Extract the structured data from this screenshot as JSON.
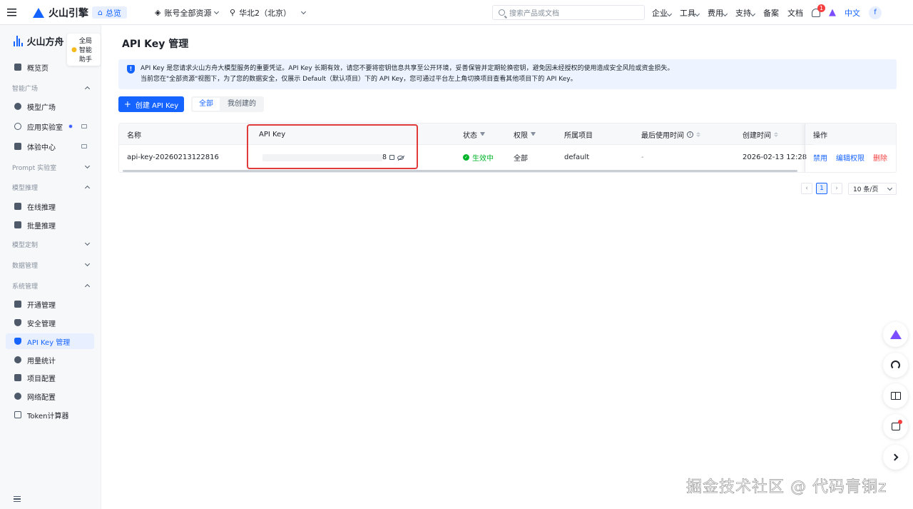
{
  "topnav": {
    "brand": "火山引擎",
    "overview": "总览",
    "account_scope": "账号全部资源",
    "region": "华北2（北京）",
    "search_placeholder": "搜索产品或文档",
    "links": [
      "企业",
      "工具",
      "费用",
      "支持",
      "备案",
      "文档"
    ],
    "notification_count": "1",
    "language": "中文",
    "avatar_letter": "f"
  },
  "sidebar": {
    "brand": "火山方舟",
    "assistant_tip": "全局智能助手",
    "overview": "概览页",
    "groups": {
      "smart_square": "智能广场",
      "prompt_lab": "Prompt 实验室",
      "model_inference": "模型推理",
      "model_custom": "模型定制",
      "data_mgmt": "数据管理",
      "system_mgmt": "系统管理"
    },
    "items": {
      "model_square": "模型广场",
      "app_lab": "应用实验室",
      "experience_center": "体验中心",
      "online_inference": "在线推理",
      "batch_inference": "批量推理",
      "activation": "开通管理",
      "security": "安全管理",
      "api_key": "API Key 管理",
      "usage": "用量统计",
      "project_config": "项目配置",
      "network_config": "网络配置",
      "token_calc": "Token计算器"
    }
  },
  "main": {
    "title": "API Key 管理",
    "notice_line1": "API Key 是您请求火山方舟大模型服务的重要凭证。API Key 长期有效，请您不要将密钥信息共享至公开环境，妥善保管并定期轮换密钥，避免因未经授权的使用造成安全风险或资金损失。",
    "notice_line2": "当前您在\"全部资源\"视图下，为了您的数据安全，仅展示 Default（默认项目）下的 API Key，您可通过平台左上角切换项目查看其他项目下的 API Key。",
    "create_button": "创建 API Key",
    "filter_all": "全部",
    "filter_mine": "我创建的",
    "columns": {
      "name": "名称",
      "api_key": "API Key",
      "status": "状态",
      "permission": "权限",
      "project": "所属项目",
      "last_used": "最后使用时间",
      "created": "创建时间",
      "actions": "操作"
    },
    "rows": [
      {
        "name": "api-key-20260213122816",
        "api_key_tail": "8",
        "status": "生效中",
        "permission": "全部",
        "project": "default",
        "last_used": "-",
        "created": "2026-02-13 12:28",
        "action_disable": "禁用",
        "action_edit": "编辑权限",
        "action_delete": "删除"
      }
    ],
    "pagination": {
      "current_page": "1",
      "page_size": "10 条/页"
    }
  },
  "watermark": "掘金技术社区 @ 代码青铜z",
  "colors": {
    "primary": "#1664ff",
    "success": "#00b42a",
    "danger": "#f53f3f",
    "highlight": "#e03a3a"
  }
}
